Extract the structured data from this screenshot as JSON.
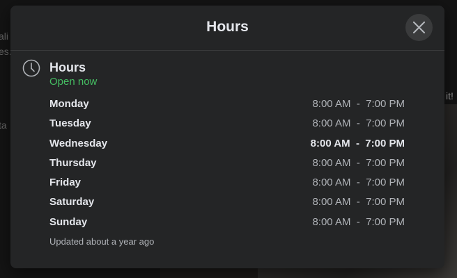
{
  "background": {
    "left_text_1": "ali",
    "left_text_2": "es.",
    "left_text_3": "ta",
    "right_text": "it!"
  },
  "modal": {
    "title": "Hours",
    "close_icon": "close-icon"
  },
  "hours": {
    "icon": "clock-icon",
    "title": "Hours",
    "status": "Open now",
    "status_color": "#45bd62",
    "days": [
      {
        "day": "Monday",
        "time": "8:00 AM  -  7:00 PM",
        "today": false
      },
      {
        "day": "Tuesday",
        "time": "8:00 AM  -  7:00 PM",
        "today": false
      },
      {
        "day": "Wednesday",
        "time": "8:00 AM  -  7:00 PM",
        "today": true
      },
      {
        "day": "Thursday",
        "time": "8:00 AM  -  7:00 PM",
        "today": false
      },
      {
        "day": "Friday",
        "time": "8:00 AM  -  7:00 PM",
        "today": false
      },
      {
        "day": "Saturday",
        "time": "8:00 AM  -  7:00 PM",
        "today": false
      },
      {
        "day": "Sunday",
        "time": "8:00 AM  -  7:00 PM",
        "today": false
      }
    ],
    "updated": "Updated about a year ago"
  }
}
